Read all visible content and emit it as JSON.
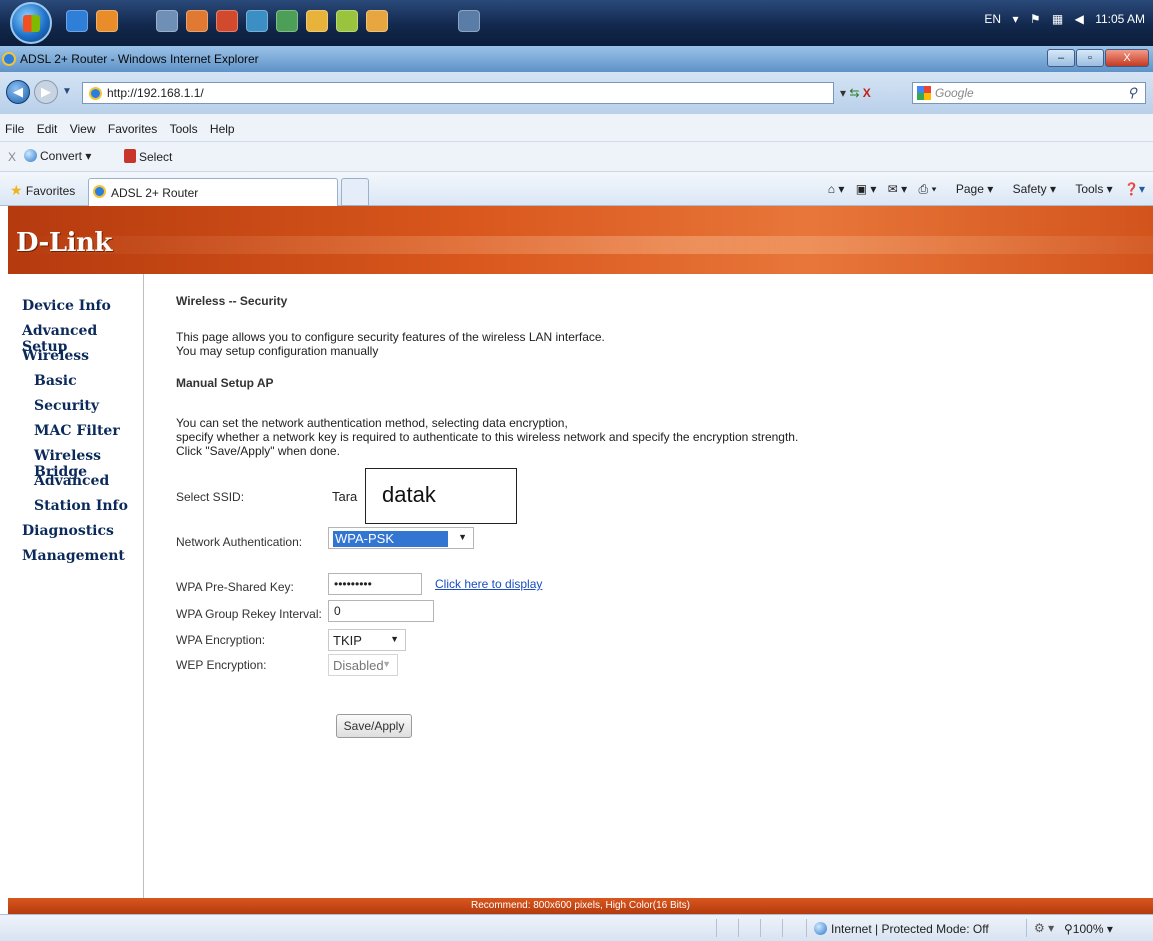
{
  "taskbar": {
    "lang": "EN",
    "time": "11:05 AM"
  },
  "window": {
    "title": "ADSL 2+ Router - Windows Internet Explorer",
    "minimize": "–",
    "maximize": "▫",
    "close": "X"
  },
  "address": {
    "url": "http://192.168.1.1/",
    "search_placeholder": "Google"
  },
  "menu": [
    "File",
    "Edit",
    "View",
    "Favorites",
    "Tools",
    "Help"
  ],
  "toolbar": {
    "close": "X",
    "convert": "Convert",
    "select": "Select"
  },
  "favorites": {
    "label": "Favorites",
    "tab_title": "ADSL 2+ Router",
    "commands": [
      "Page",
      "Safety",
      "Tools"
    ]
  },
  "brand": "D-Link",
  "nav": [
    "Device Info",
    "Advanced Setup",
    "Wireless",
    "Basic",
    "Security",
    "MAC Filter",
    "Wireless Bridge",
    "Advanced",
    "Station Info",
    "Diagnostics",
    "Management"
  ],
  "content": {
    "heading": "Wireless -- Security",
    "intro_1": "This page allows you to configure security features of the wireless LAN interface.",
    "intro_2": "You may setup configuration manually",
    "subheading": "Manual Setup AP",
    "desc_1": "You can set the network authentication method, selecting data encryption,",
    "desc_2": "specify whether a network key is required to authenticate to this wireless network and specify the encryption strength.",
    "desc_3": "Click \"Save/Apply\" when done.",
    "ssid_label": "Select SSID:",
    "ssid_value": "Tara",
    "ssid_overlay": "datak",
    "auth_label": "Network Authentication:",
    "auth_value": "WPA-PSK",
    "psk_label": "WPA Pre-Shared Key:",
    "psk_value": "•••••••••",
    "psk_link": "Click here to display",
    "rekey_label": "WPA Group Rekey Interval:",
    "rekey_value": "0",
    "wpa_enc_label": "WPA Encryption:",
    "wpa_enc_value": "TKIP",
    "wep_enc_label": "WEP Encryption:",
    "wep_enc_value": "Disabled",
    "save_label": "Save/Apply"
  },
  "footer": "Recommend: 800x600 pixels, High Color(16 Bits)",
  "status": {
    "zone": "Internet | Protected Mode: Off",
    "zoom": "100%"
  }
}
